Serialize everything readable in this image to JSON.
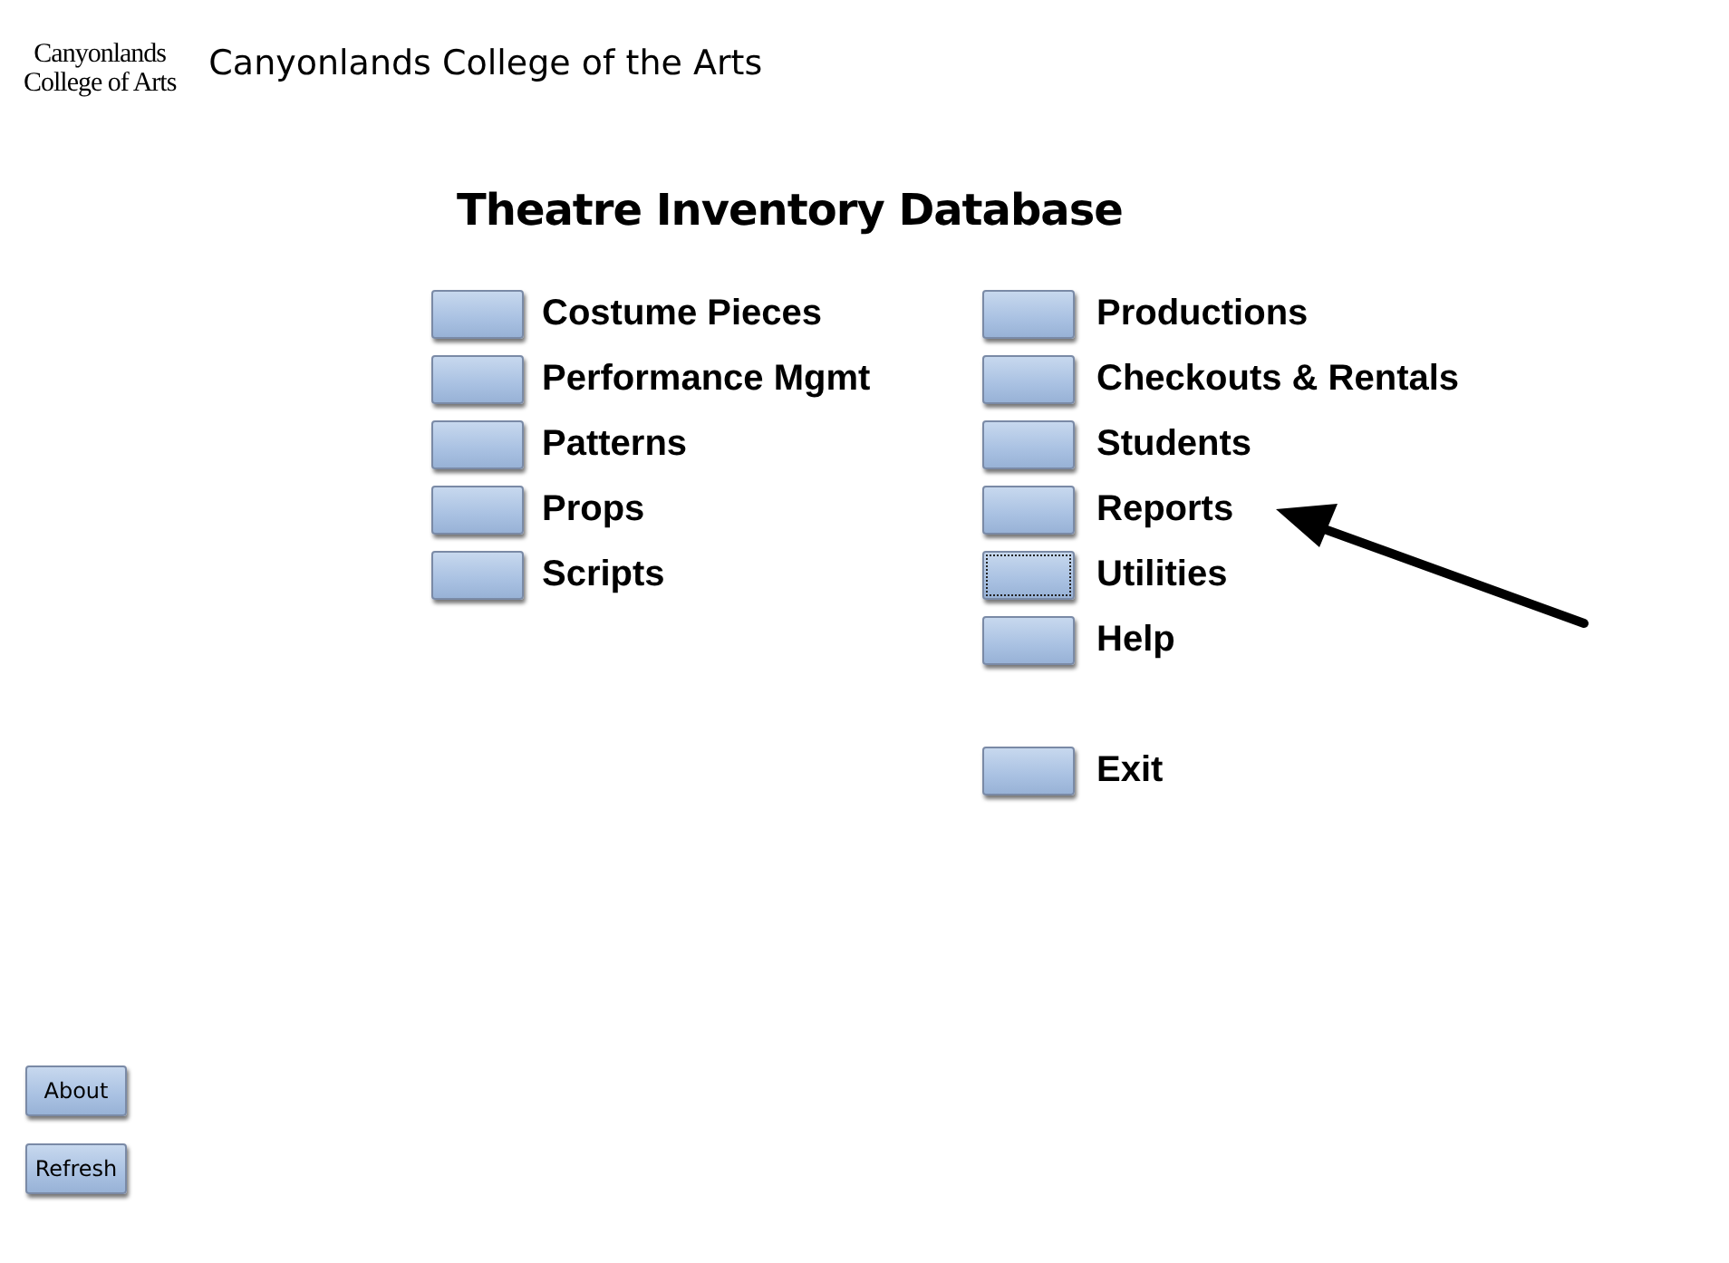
{
  "logo": {
    "lines": [
      "Canyonlands",
      "College of Arts"
    ]
  },
  "header": {
    "title": "Canyonlands College of the Arts"
  },
  "page_title": "Theatre Inventory Database",
  "menu_columns": [
    {
      "groups": [
        {
          "items": [
            {
              "label": "Costume Pieces",
              "focused": false
            },
            {
              "label": "Performance Mgmt",
              "focused": false
            },
            {
              "label": "Patterns",
              "focused": false
            },
            {
              "label": "Props",
              "focused": false
            },
            {
              "label": "Scripts",
              "focused": false
            }
          ]
        }
      ]
    },
    {
      "groups": [
        {
          "items": [
            {
              "label": "Productions",
              "focused": false
            },
            {
              "label": "Checkouts & Rentals",
              "focused": false
            },
            {
              "label": "Students",
              "focused": false
            },
            {
              "label": "Reports",
              "focused": false
            },
            {
              "label": "Utilities",
              "focused": true
            },
            {
              "label": "Help",
              "focused": false
            }
          ]
        },
        {
          "items": [
            {
              "label": "Exit",
              "focused": false
            }
          ]
        }
      ]
    }
  ],
  "footer_buttons": [
    "About",
    "Refresh"
  ]
}
